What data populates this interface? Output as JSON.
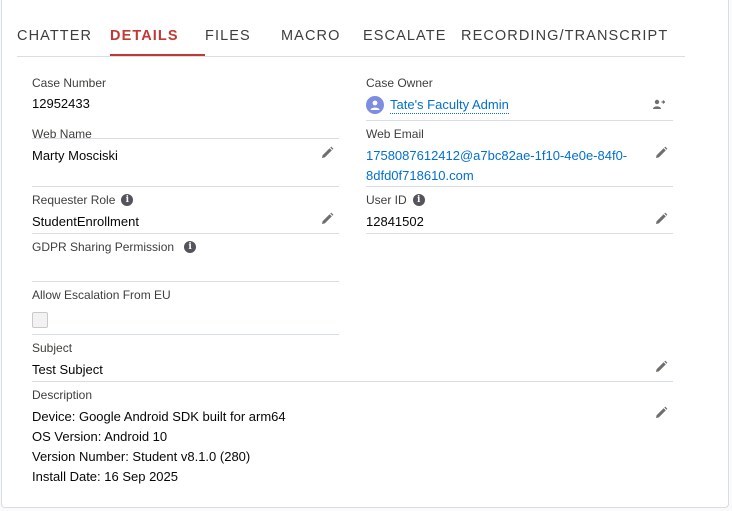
{
  "tabs": [
    {
      "label": "CHATTER"
    },
    {
      "label": "DETAILS",
      "active": true
    },
    {
      "label": "FILES"
    },
    {
      "label": "MACRO"
    },
    {
      "label": "ESCALATE"
    },
    {
      "label": "RECORDING/TRANSCRIPT"
    }
  ],
  "fields": {
    "case_number": {
      "label": "Case Number",
      "value": "12952433"
    },
    "case_owner": {
      "label": "Case Owner",
      "value": "Tate's Faculty Admin"
    },
    "web_name": {
      "label": "Web Name",
      "value": "Marty Mosciski"
    },
    "web_email": {
      "label": "Web Email",
      "value_line1": "1758087612412@a7bc82ae-1f10-4e0e-84f0-",
      "value_line2": "8dfd0f718610.com"
    },
    "requester_role": {
      "label": "Requester Role",
      "value": "StudentEnrollment"
    },
    "user_id": {
      "label": "User ID",
      "value": "12841502"
    },
    "gdpr": {
      "label": "GDPR Sharing Permission",
      "value": ""
    },
    "allow_escalation": {
      "label": "Allow Escalation From EU",
      "checked": false
    },
    "subject": {
      "label": "Subject",
      "value": "Test Subject"
    },
    "description": {
      "label": "Description",
      "lines": [
        "Device: Google Android SDK built for arm64",
        "OS Version: Android 10",
        "Version Number: Student v8.1.0 (280)",
        "Install Date: 16 Sep 2025"
      ]
    }
  },
  "colors": {
    "accent": "#c23934",
    "link": "#0070d2",
    "divider": "#d8dde6"
  }
}
